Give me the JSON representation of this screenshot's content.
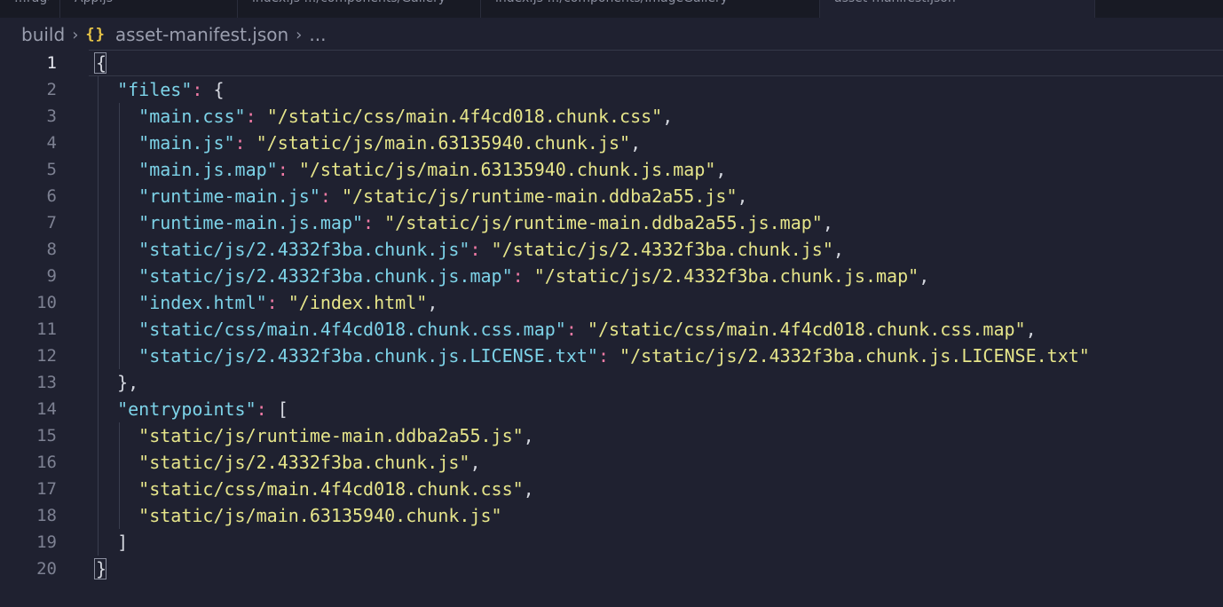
{
  "tabs": [
    {
      "label": "…rage.js",
      "active": false
    },
    {
      "label": "App.js",
      "active": false
    },
    {
      "label": "index.js  …/components/Gallery",
      "active": false
    },
    {
      "label": "index.js  …/components/ImageGallery",
      "active": false
    },
    {
      "label": "asset-manifest.json",
      "active": true
    }
  ],
  "breadcrumb": {
    "folder": "build",
    "icon": "{}",
    "file": "asset-manifest.json",
    "more": "..."
  },
  "colors": {
    "background": "#1f2130",
    "key": "#7dd3e8",
    "string": "#e6e58a",
    "colon": "#f07aa5",
    "json_icon": "#e8c547"
  },
  "editor": {
    "current_line": 1,
    "lines": [
      {
        "n": "1",
        "text": "{"
      },
      {
        "n": "2",
        "text": "  \"files\": {"
      },
      {
        "n": "3",
        "text": "    \"main.css\": \"/static/css/main.4f4cd018.chunk.css\","
      },
      {
        "n": "4",
        "text": "    \"main.js\": \"/static/js/main.63135940.chunk.js\","
      },
      {
        "n": "5",
        "text": "    \"main.js.map\": \"/static/js/main.63135940.chunk.js.map\","
      },
      {
        "n": "6",
        "text": "    \"runtime-main.js\": \"/static/js/runtime-main.ddba2a55.js\","
      },
      {
        "n": "7",
        "text": "    \"runtime-main.js.map\": \"/static/js/runtime-main.ddba2a55.js.map\","
      },
      {
        "n": "8",
        "text": "    \"static/js/2.4332f3ba.chunk.js\": \"/static/js/2.4332f3ba.chunk.js\","
      },
      {
        "n": "9",
        "text": "    \"static/js/2.4332f3ba.chunk.js.map\": \"/static/js/2.4332f3ba.chunk.js.map\","
      },
      {
        "n": "10",
        "text": "    \"index.html\": \"/index.html\","
      },
      {
        "n": "11",
        "text": "    \"static/css/main.4f4cd018.chunk.css.map\": \"/static/css/main.4f4cd018.chunk.css.map\","
      },
      {
        "n": "12",
        "text": "    \"static/js/2.4332f3ba.chunk.js.LICENSE.txt\": \"/static/js/2.4332f3ba.chunk.js.LICENSE.txt\""
      },
      {
        "n": "13",
        "text": "  },"
      },
      {
        "n": "14",
        "text": "  \"entrypoints\": ["
      },
      {
        "n": "15",
        "text": "    \"static/js/runtime-main.ddba2a55.js\","
      },
      {
        "n": "16",
        "text": "    \"static/js/2.4332f3ba.chunk.js\","
      },
      {
        "n": "17",
        "text": "    \"static/css/main.4f4cd018.chunk.css\","
      },
      {
        "n": "18",
        "text": "    \"static/js/main.63135940.chunk.js\""
      },
      {
        "n": "19",
        "text": "  ]"
      },
      {
        "n": "20",
        "text": "}"
      }
    ]
  }
}
